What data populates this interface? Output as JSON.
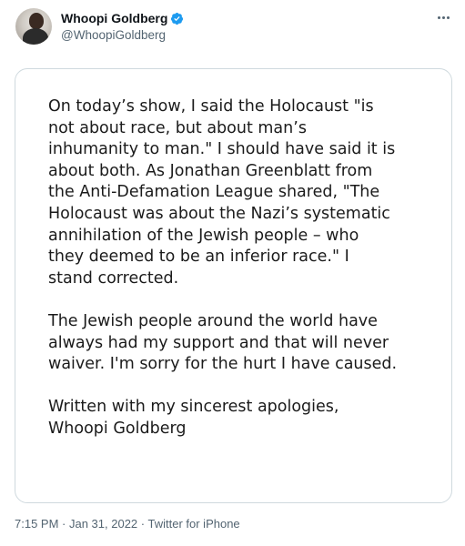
{
  "author": {
    "display_name": "Whoopi Goldberg",
    "handle": "@WhoopiGoldberg",
    "verified": true,
    "avatar_icon": "profile-photo",
    "verified_icon": "verified-badge-icon",
    "verified_color": "#1d9bf0"
  },
  "menu": {
    "icon": "more-options-icon"
  },
  "statement": {
    "paragraphs": [
      "On today’s show, I said the Holocaust \"is\nnot about race, but about man’s\ninhumanity to man.\" I should have said it is\nabout both. As Jonathan Greenblatt from\nthe Anti-Defamation League shared, \"The\nHolocaust was about the Nazi’s systematic\nannihilation of the Jewish people – who\nthey deemed to be an inferior race.\" I\nstand corrected.",
      "The Jewish people around the world have\nalways had my support and that will never\nwaiver. I'm sorry for the hurt I have caused.",
      "Written with my sincerest apologies,\nWhoopi Goldberg"
    ]
  },
  "meta": {
    "time": "7:15 PM",
    "separator": " · ",
    "date": "Jan 31, 2022",
    "source": "Twitter for iPhone"
  },
  "colors": {
    "text_primary": "#0f1419",
    "text_secondary": "#536471",
    "border": "#cfd9de"
  }
}
